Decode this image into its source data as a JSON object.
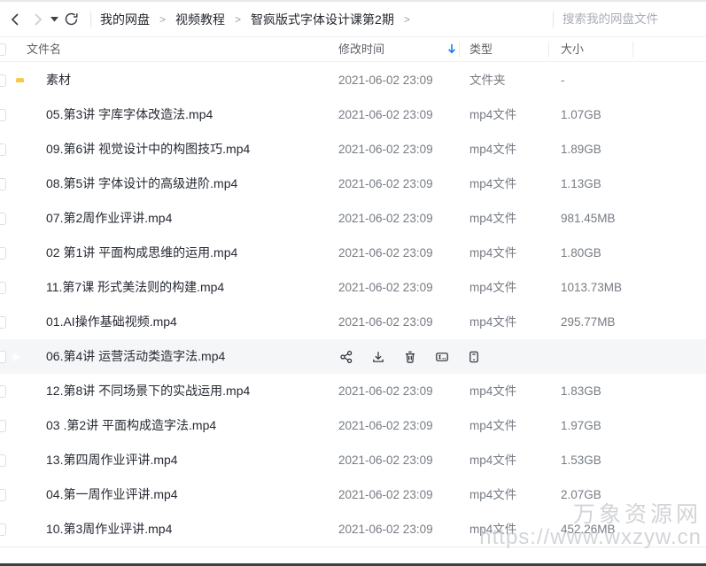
{
  "toolbar": {
    "breadcrumb": {
      "items": [
        "我的网盘",
        "视频教程",
        "智疯版式字体设计课第2期"
      ],
      "separator": ">"
    },
    "search_placeholder": "搜索我的网盘文件"
  },
  "table": {
    "headers": {
      "name": "文件名",
      "modified": "修改时间",
      "type": "类型",
      "size": "大小"
    },
    "sort": {
      "column": "修改时间",
      "direction": "desc"
    },
    "hover_actions": [
      "share",
      "download",
      "delete",
      "rename",
      "more"
    ],
    "rows": [
      {
        "icon": "folder-icon",
        "name": "素材",
        "modified": "2021-06-02 23:09",
        "type": "文件夹",
        "size": "-"
      },
      {
        "icon": "video-icon",
        "name": "05.第3讲 字库字体改造法.mp4",
        "modified": "2021-06-02 23:09",
        "type": "mp4文件",
        "size": "1.07GB"
      },
      {
        "icon": "video-icon",
        "name": "09.第6讲 视觉设计中的构图技巧.mp4",
        "modified": "2021-06-02 23:09",
        "type": "mp4文件",
        "size": "1.89GB"
      },
      {
        "icon": "video-icon",
        "name": "08.第5讲 字体设计的高级进阶.mp4",
        "modified": "2021-06-02 23:09",
        "type": "mp4文件",
        "size": "1.13GB"
      },
      {
        "icon": "video-icon",
        "name": "07.第2周作业评讲.mp4",
        "modified": "2021-06-02 23:09",
        "type": "mp4文件",
        "size": "981.45MB"
      },
      {
        "icon": "video-icon",
        "name": "02 第1讲 平面构成思维的运用.mp4",
        "modified": "2021-06-02 23:09",
        "type": "mp4文件",
        "size": "1.80GB"
      },
      {
        "icon": "video-icon",
        "name": "11.第7课 形式美法则的构建.mp4",
        "modified": "2021-06-02 23:09",
        "type": "mp4文件",
        "size": "1013.73MB"
      },
      {
        "icon": "video-icon",
        "name": "01.AI操作基础视频.mp4",
        "modified": "2021-06-02 23:09",
        "type": "mp4文件",
        "size": "295.77MB"
      },
      {
        "icon": "video-icon",
        "name": "06.第4讲 运营活动类造字法.mp4",
        "hover": true
      },
      {
        "icon": "video-icon",
        "name": "12.第8讲 不同场景下的实战运用.mp4",
        "modified": "2021-06-02 23:09",
        "type": "mp4文件",
        "size": "1.83GB"
      },
      {
        "icon": "video-icon",
        "name": "03 .第2讲 平面构成造字法.mp4",
        "modified": "2021-06-02 23:09",
        "type": "mp4文件",
        "size": "1.97GB"
      },
      {
        "icon": "video-icon",
        "name": "13.第四周作业评讲.mp4",
        "modified": "2021-06-02 23:09",
        "type": "mp4文件",
        "size": "1.53GB"
      },
      {
        "icon": "video-icon",
        "name": "04.第一周作业评讲.mp4",
        "modified": "2021-06-02 23:09",
        "type": "mp4文件",
        "size": "2.07GB"
      },
      {
        "icon": "video-icon",
        "name": "10.第3周作业评讲.mp4",
        "modified": "2021-06-02 23:09",
        "type": "mp4文件",
        "size": "452.26MB"
      }
    ]
  },
  "watermark": {
    "line1": "万象资源网",
    "line2": "https://www.wxzyw.cn"
  },
  "colors": {
    "accent_blue": "#1777fd",
    "folder_yellow": "#f9c84c",
    "video_purple": "#7b7de9",
    "hover_bg": "#f5f6f7"
  }
}
